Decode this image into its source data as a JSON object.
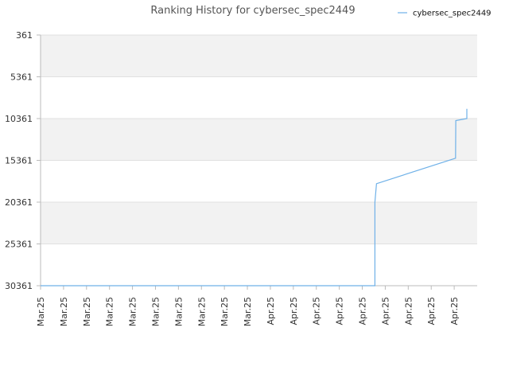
{
  "chart_data": {
    "type": "line",
    "title": "Ranking History for cybersec_spec2449",
    "legend": {
      "position": "top-right",
      "entries": [
        "cybersec_spec2449"
      ]
    },
    "grid": true,
    "y_inverted": true,
    "ylim": [
      361,
      30361
    ],
    "y_ticks": [
      "361",
      "5361",
      "10361",
      "15361",
      "20361",
      "25361",
      "30361"
    ],
    "x_tick_labels": [
      "Mar.25",
      "Mar.25",
      "Mar.25",
      "Mar.25",
      "Mar.25",
      "Mar.25",
      "Mar.25",
      "Mar.25",
      "Mar.25",
      "Mar.25",
      "Apr.25",
      "Apr.25",
      "Apr.25",
      "Apr.25",
      "Apr.25",
      "Apr.25",
      "Apr.25",
      "Apr.25",
      "Apr.25"
    ],
    "x_range": [
      0,
      19
    ],
    "series": [
      {
        "name": "cybersec_spec2449",
        "color": "#6fb1e8",
        "points": [
          {
            "x": 0.0,
            "y": 30361
          },
          {
            "x": 14.55,
            "y": 30361
          },
          {
            "x": 14.55,
            "y": 20361
          },
          {
            "x": 14.62,
            "y": 18150
          },
          {
            "x": 18.06,
            "y": 15100
          },
          {
            "x": 18.07,
            "y": 10600
          },
          {
            "x": 18.55,
            "y": 10361
          },
          {
            "x": 18.55,
            "y": 9200
          }
        ]
      }
    ],
    "colors": {
      "band": "#f2f2f2",
      "grid": "#e0e0e0",
      "axis": "#bbbbbb"
    }
  }
}
